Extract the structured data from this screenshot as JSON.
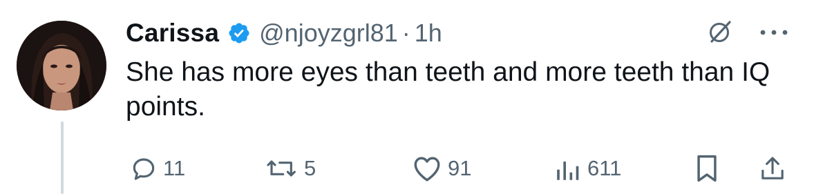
{
  "author": {
    "name": "Carissa",
    "handle": "@njoyzgrl81",
    "separator": "·",
    "time": "1h",
    "verified_color": "#1d9bf0"
  },
  "tweet": {
    "text": "She has more eyes than teeth and more teeth than IQ points."
  },
  "actions": {
    "replies": "11",
    "retweets": "5",
    "likes": "91",
    "views": "611"
  },
  "icons": {
    "reply": "speech-bubble",
    "retweet": "two-arrows-cycle",
    "like": "heart",
    "views": "bar-chart",
    "bookmark": "bookmark",
    "share": "upload-arrow",
    "grok": "grok-slash-circle",
    "more": "three-dots"
  },
  "colors": {
    "text": "#0f1419",
    "secondary": "#536471",
    "thread_line": "#cfd9de"
  }
}
